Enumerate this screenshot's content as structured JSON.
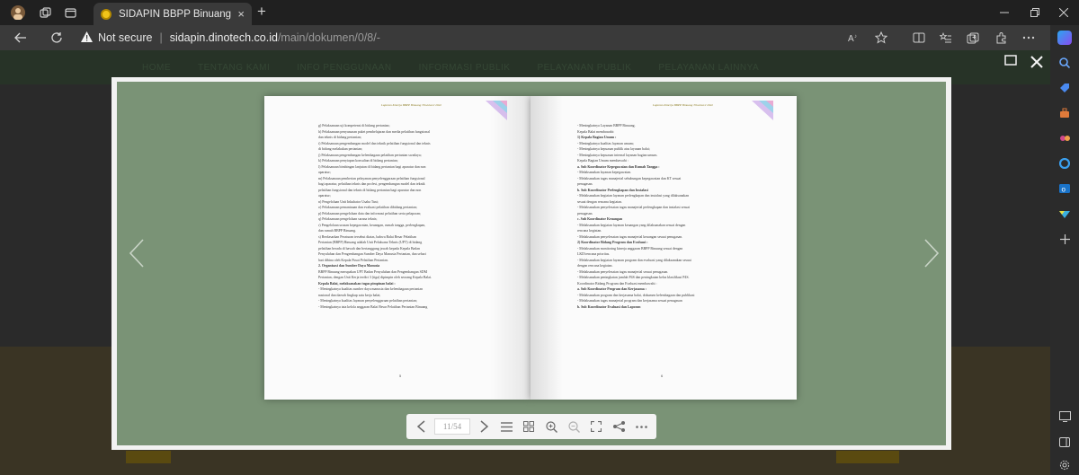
{
  "browser": {
    "tab_title": "SIDAPIN BBPP Binuang",
    "tab_close": "×",
    "new_tab": "+",
    "security_label": "Not secure",
    "url_host": "sidapin.dinotech.co.id",
    "url_path": "/main/dokumen/0/8/-",
    "separator": "|"
  },
  "site_nav": [
    "HOME",
    "TENTANG KAMI",
    "INFO PENGGUNAAN",
    "INFORMASI PUBLIK",
    "PELAYANAN PUBLIK",
    "PELAYANAN LAINNYA"
  ],
  "viewer": {
    "page_indicator": "11/54"
  },
  "book": {
    "left_header": "Laporan Kinerja BBPP Binuang Triwulan I 2022",
    "right_header": "Laporan Kinerja BBPP Binuang Triwulan I 2022",
    "left_lines": [
      "g) Pelaksanaan uji kompetensi di bidang pertanian;",
      "h) Pelaksanaan penyusunan paket pembelajaran dan media pelatihan fungsional",
      "    dan teknis di bidang pertanian;",
      "i) Pelaksanaan pengembangan model dan teknik pelatihan fungsional dan teknis",
      "    di bidang melakukan pertanian;",
      "j) Pelaksanaan pengembangan kelembagaan pelatihan pertanian swadaya;",
      "k) Pelaksanaan penyiapan konsultan di bidang pertanian;",
      "l) Pelaksanaan bimbingan lanjutan di bidang pertanian bagi aparatur dan non",
      "    aparatur;",
      "m) Pelaksanaan pemberian pelayanan penyelenggaraan pelatihan fungsional",
      "    bagi aparatur, pelatihan teknis dan profesi, pengembangan model dan teknik",
      "    pelatihan fungsional dan teknis di bidang pertanian bagi aparatur dan non",
      "    aparatur;",
      "n) Pengelolaan Unit Inkubator Usaha Tani;",
      "o) Pelaksanaan pemantauan dan evaluasi pelatihan dibidang pertanian;",
      "p) Pelaksanaan pengelolaan data dan informasi pelatihan serta pelaporan;",
      "q) Pelaksanaan pengelolaan sarana teknis;",
      "r) Pengelolaan urusan kepegawaian, keuangan, rumah tangga, perlengkapan,",
      "    dan rumah BBPP Binuang.",
      "s) Berdasarkan Peraturan tersebut diatas, bahwa Balai Besar Pelatihan",
      "    Pertanian (BBPP) Binuang adalah Unit Pelaksana Teknis (UPT) di bidang",
      "    pelatihan berada di bawah dan bertanggung jawab kepada Kepala Badan",
      "    Penyuluhan dan Pengembangan Sumber Daya Manusia Pertanian, dan sehari",
      "    hari dibina oleh Kepala Pusat Pelatihan Pertanian.",
      "2.  Organisasi dan Sumber Daya Manusia",
      "    BBPP Binuang merupakan UPT Badan Penyuluhan dan Pengembangan SDM",
      "    Pertanian, dengan Unit Kerja terdiri 3 (tiga) dipimpin oleh seorang Kepala Balai.",
      "    Kepala Balai, melaksanakan tugas pimpinan balai :",
      "-   Meningkatnya kualitas sumber daya manusia dan kelembagaan pertanian",
      "    nasional dan daerah lingkup satu kerja balai;",
      "-   Meningkatnya kualitas layanan penyelenggaraan pelatihan pertanian;",
      "-   Meningkatnya tata kelola anggaran Balai Besar Pelatihan Pertanian Binuang"
    ],
    "right_lines": [
      "-   Meningkatnya Layanan BBPP Binuang.",
      "    Kepala Balai membawahi:",
      "1)  Kepala Bagian Umum :",
      "-   Meningkatnya kualitas layanan umum;",
      "-   Meningkatnya kepuasan publik atas layanan balai;",
      "-   Meningkatnya kepuasan internal layanan bagian umum.",
      "    Kepala Bagian Umum membawahi :",
      "a.  Sub Koordinator Kepegawaian dan Rumah Tangga :",
      "-   Melaksanakan layanan kepegawaian.",
      "-   Melaksanakan tugas manajerial sehubungan kepegawaian dan KT sesuai",
      "    penugasan.",
      "b.  Sub Koordinator Perlengkapan dan Instalasi",
      "-   Melaksanakan kegiatan layanan perlengkapan dan instalasi yang dilaksanakan",
      "    sesuai dengan rencana kegiatan.",
      "-   Melaksanakan penyelesaian tugas manajerial perlengkapan dan instalasi sesuai",
      "    penugasan.",
      "c.  Sub Koordinator Keuangan",
      "-   Melaksanakan kegiatan layanan keuangan yang dilaksanakan sesuai dengan",
      "    rencana kegiatan.",
      "-   Melaksanakan penyelesaian tugas manajerial keuangan sesuai penugasan.",
      "2)  Koordinator Bidang Program dan Evaluasi :",
      "-   Melaksanakan monitoring kinerja anggaran BBPP Binuang sesuai dengan",
      "    LKD/rencana prioritas.",
      "-   Melaksanakan kegiatan layanan program dan evaluasi yang dilaksanakan sesuai",
      "    dengan rencana kegiatan.",
      "-   Melaksanakan penyelesaian tugas manajerial sesuai penugasan.",
      "-   Melaksanakan peningkatan jumlah P4S dan peningkatan kelas klasifikasi P4S.",
      "    Koordinator Bidang Program dan Evaluasi membawahi :",
      "a.  Sub Koordinator Program dan Kerjasama :",
      "-   Melaksanakan program dan kerjasama balai, dokumen kelembagaan dan publikasi",
      "-   Melaksanakan tugas manajerial program dan kerjasama sesuai penugasan",
      "b.  Sub Koordinator Evaluasi dan Laporan"
    ],
    "left_page_number": "5",
    "right_page_number": "6"
  }
}
